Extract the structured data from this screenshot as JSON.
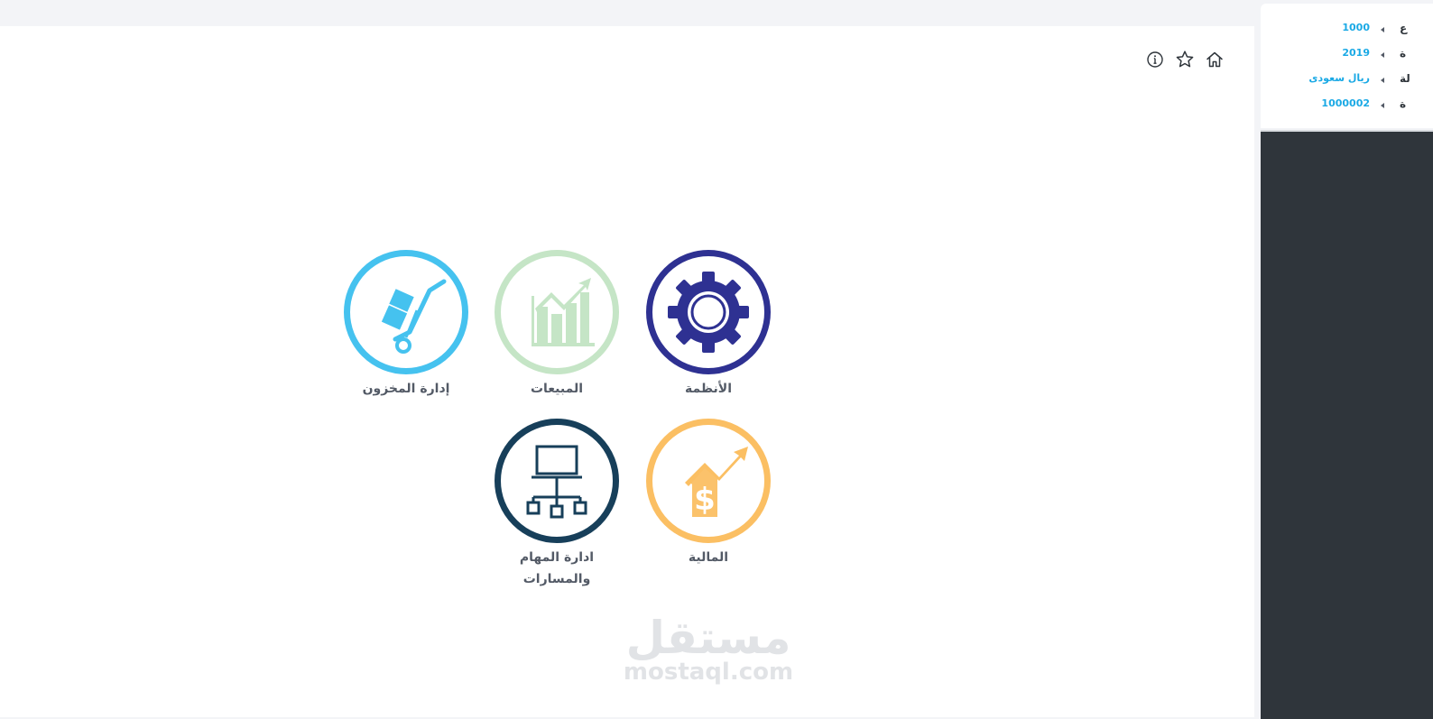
{
  "toolbar": {
    "icons": [
      "info-icon",
      "star-icon",
      "home-icon"
    ]
  },
  "modules": [
    {
      "label": "الأنظمة",
      "icon": "gear-icon",
      "color": "#2e3192"
    },
    {
      "label": "المبيعات",
      "icon": "bar-chart-growth-icon",
      "color": "#c5e5c6"
    },
    {
      "label": "إدارة المخزون",
      "icon": "hand-truck-icon",
      "color": "#45c2ef"
    },
    {
      "label": "المالية",
      "icon": "dollar-growth-icon",
      "color": "#fbbf63"
    },
    {
      "label_line1": "ادارة المهام",
      "label_line2": "والمسارات",
      "icon": "network-monitor-icon",
      "color": "#173f5a"
    }
  ],
  "watermark": {
    "arabic": "مستقل",
    "latin": "mostaql.com"
  },
  "side_panel": {
    "rows": [
      {
        "label": "ع",
        "value": "1000"
      },
      {
        "label": "ة",
        "value": "2019"
      },
      {
        "label": "لة",
        "value": "ريال سعودى"
      },
      {
        "label": "ة",
        "value": "1000002"
      }
    ]
  },
  "colors": {
    "accent_value": "#1aa9e5",
    "sidebar_dark": "#2f353b",
    "page_bg": "#f3f4f7",
    "label_text": "#535a66"
  }
}
